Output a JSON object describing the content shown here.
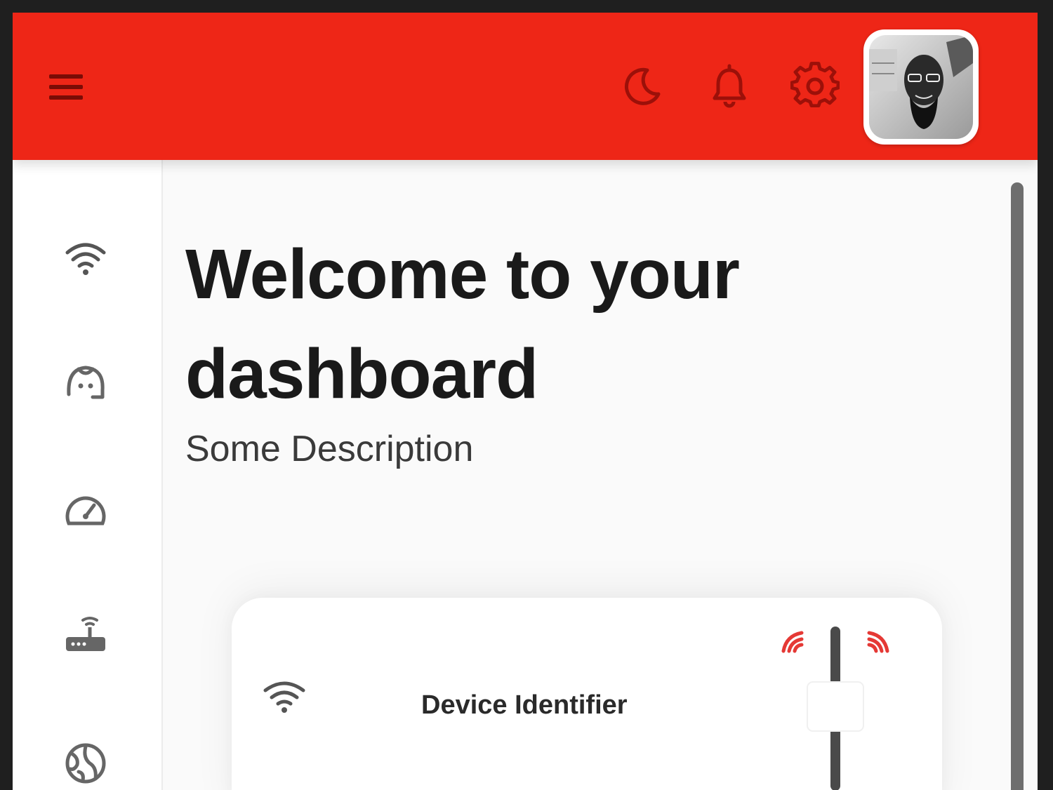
{
  "header": {
    "icons": [
      "menu-icon",
      "moon-icon",
      "bell-icon",
      "gear-icon",
      "user-avatar"
    ],
    "accent_color": "#ee2617"
  },
  "sidebar": {
    "items": [
      {
        "icon": "wifi-icon"
      },
      {
        "icon": "face-icon"
      },
      {
        "icon": "speedometer-icon"
      },
      {
        "icon": "router-icon"
      },
      {
        "icon": "globe-icon"
      }
    ]
  },
  "main": {
    "title": "Welcome to your dashboard",
    "description": "Some Description"
  },
  "card": {
    "label": "Device Identifier",
    "icon": "wifi-icon",
    "toggle": {
      "icon": "signal-toggle-icon",
      "accent_color": "#e53935"
    }
  }
}
